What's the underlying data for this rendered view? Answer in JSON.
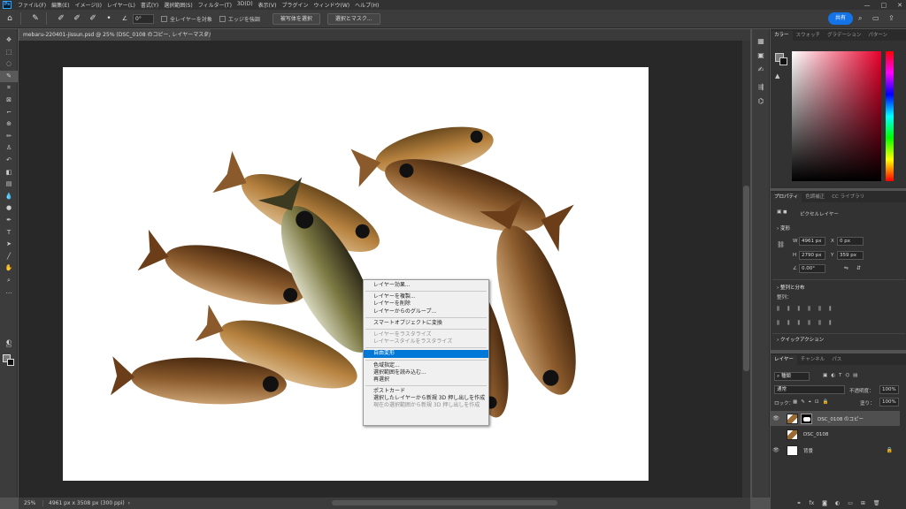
{
  "app": {
    "logo": "Ps"
  },
  "menu": [
    "ファイル(F)",
    "編集(E)",
    "イメージ(I)",
    "レイヤー(L)",
    "書式(Y)",
    "選択範囲(S)",
    "フィルター(T)",
    "3D(D)",
    "表示(V)",
    "プラグイン",
    "ウィンドウ(W)",
    "ヘルプ(H)"
  ],
  "window_controls": {
    "minimize": "—",
    "maximize": "□",
    "close": "✕"
  },
  "options": {
    "angle_value": "0°",
    "sample_all_layers": "全レイヤーを対象",
    "enhance_edge": "エッジを強調",
    "select_subject": "被写体を選択",
    "select_and_mask": "選択とマスク...",
    "share": "共有"
  },
  "document": {
    "tab_title": "mebaru-220401-jissun.psd @ 25% (DSC_0108 のコピー, レイヤーマスク/8) *",
    "close": "×"
  },
  "status": {
    "zoom": "25%",
    "info": "4961 px x 3508 px (300 ppi)",
    "arrow": "›"
  },
  "context_menu": {
    "groups": [
      [
        {
          "label": "レイヤー効果...",
          "state": "normal"
        }
      ],
      [
        {
          "label": "レイヤーを複製...",
          "state": "normal"
        },
        {
          "label": "レイヤーを削除",
          "state": "normal"
        },
        {
          "label": "レイヤーからのグループ...",
          "state": "normal"
        }
      ],
      [
        {
          "label": "スマートオブジェクトに変換",
          "state": "normal"
        }
      ],
      [
        {
          "label": "レイヤーをラスタライズ",
          "state": "disabled"
        },
        {
          "label": "レイヤースタイルをラスタライズ",
          "state": "disabled"
        }
      ],
      [
        {
          "label": "自由変形",
          "state": "selected"
        }
      ],
      [
        {
          "label": "色域指定...",
          "state": "normal"
        },
        {
          "label": "選択範囲を読み込む...",
          "state": "normal"
        },
        {
          "label": "再選択",
          "state": "normal"
        }
      ],
      [
        {
          "label": "ポストカード",
          "state": "normal"
        },
        {
          "label": "選択したレイヤーから新規 3D 押し出しを作成",
          "state": "normal"
        },
        {
          "label": "現在の選択範囲から新規 3D 押し出しを作成",
          "state": "disabled"
        }
      ]
    ]
  },
  "color_panel": {
    "tabs": [
      "カラー",
      "スウォッチ",
      "グラデーション",
      "パターン"
    ]
  },
  "properties_panel": {
    "tabs": [
      "プロパティ",
      "色調補正",
      "CC ライブラリ"
    ],
    "layer_type": "ピクセルレイヤー",
    "transform_title": "変形",
    "w_label": "W",
    "w_value": "4961 px",
    "h_label": "H",
    "h_value": "2790 px",
    "x_label": "X",
    "x_value": "0 px",
    "y_label": "Y",
    "y_value": "359 px",
    "angle_value": "0.00°",
    "align_title": "整列と分布",
    "align_label": "整列：",
    "quick_actions": "クイックアクション"
  },
  "layers_panel": {
    "tabs": [
      "レイヤー",
      "チャンネル",
      "パス"
    ],
    "filter_kind": "種類",
    "blend_mode": "通常",
    "opacity_label": "不透明度：",
    "opacity_value": "100%",
    "lock_label": "ロック：",
    "fill_label": "塗り：",
    "fill_value": "100%",
    "layers": [
      {
        "name": "DSC_0108 のコピー",
        "visible": true,
        "mask": true,
        "active": true,
        "locked": false
      },
      {
        "name": "DSC_0108",
        "visible": false,
        "mask": false,
        "active": false,
        "locked": false
      },
      {
        "name": "背景",
        "visible": true,
        "mask": false,
        "active": false,
        "locked": true
      }
    ]
  },
  "colors": {
    "accent": "#1473e6",
    "menu_highlight": "#0078d7",
    "canvas_bg": "#ffffff",
    "workspace": "#282828"
  }
}
